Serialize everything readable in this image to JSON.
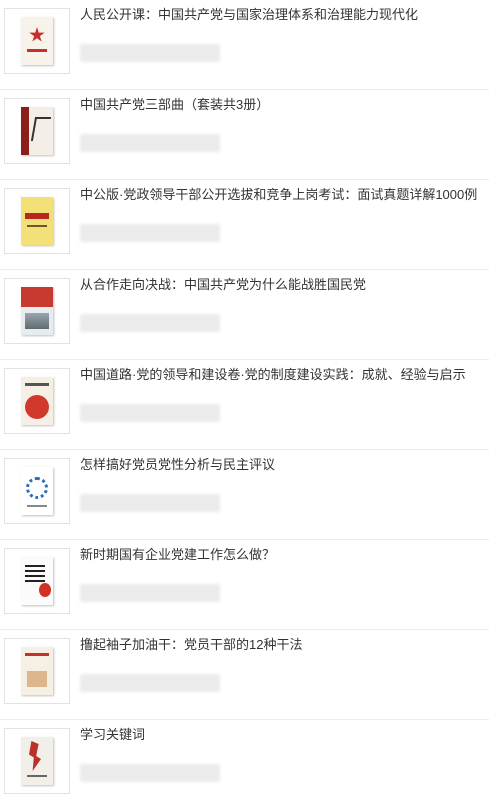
{
  "books": [
    {
      "title": "人民公开课：中国共产党与国家治理体系和治理能力现代化",
      "cover_icon": "book-cover-red-star"
    },
    {
      "title": "中国共产党三部曲（套装共3册）",
      "cover_icon": "book-cover-calligraphy"
    },
    {
      "title": "中公版·党政领导干部公开选拔和竞争上岗考试：面试真题详解1000例",
      "cover_icon": "book-cover-yellow"
    },
    {
      "title": "从合作走向决战：中国共产党为什么能战胜国民党",
      "cover_icon": "book-cover-red-photo"
    },
    {
      "title": "中国道路·党的领导和建设卷·党的制度建设实践：成就、经验与启示",
      "cover_icon": "book-cover-red-circle"
    },
    {
      "title": "怎样搞好党员党性分析与民主评议",
      "cover_icon": "book-cover-blue-ring"
    },
    {
      "title": "新时期国有企业党建工作怎么做？",
      "cover_icon": "book-cover-question"
    },
    {
      "title": "撸起袖子加油干：党员干部的12种干法",
      "cover_icon": "book-cover-sleeves"
    },
    {
      "title": "学习关键词",
      "cover_icon": "book-cover-brush"
    }
  ],
  "colors": {
    "divider": "#ececec",
    "title_text": "#333333",
    "price_placeholder": "#ebebeb"
  }
}
